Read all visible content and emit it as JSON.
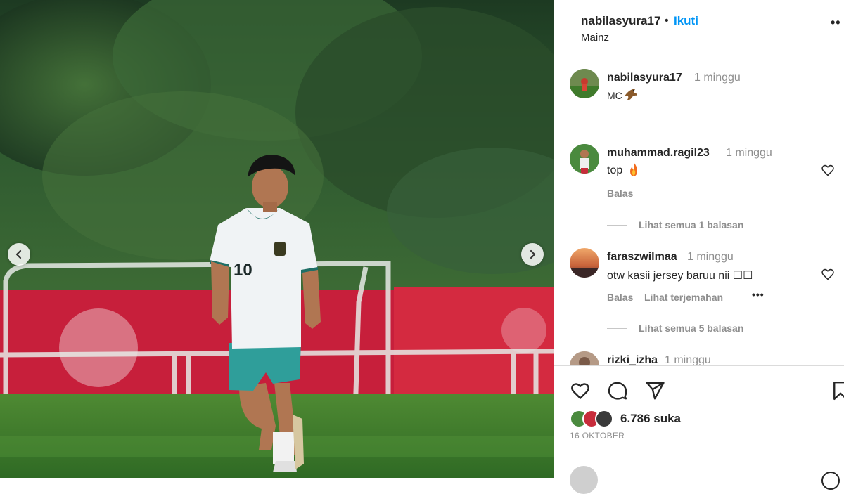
{
  "post": {
    "username": "nabilasyura17",
    "follow_label": "Ikuti",
    "location": "Mainz",
    "more_label": "••"
  },
  "photo": {
    "jersey_number": "10",
    "nav_prev_icon": "chevron-left-icon",
    "nav_next_icon": "chevron-right-icon"
  },
  "caption": {
    "username": "nabilasyura17",
    "time": "1 minggu",
    "text": "MC"
  },
  "comments": [
    {
      "username": "muhammad.ragil23",
      "time": "1 minggu",
      "text": "top",
      "reply_label": "Balas",
      "view_replies": "Lihat semua 1 balasan"
    },
    {
      "username": "faraszwilmaa",
      "time": "1 minggu",
      "text": "otw kasii jersey baruu nii ☐☐",
      "reply_label": "Balas",
      "translate_label": "Lihat terjemahan",
      "more_label": "•••",
      "view_replies": "Lihat semua 5 balasan"
    },
    {
      "username": "rizki_izha",
      "time": "1 minggu"
    }
  ],
  "actions": {
    "like_icon": "heart-icon",
    "comment_icon": "comment-icon",
    "share_icon": "share-icon",
    "save_icon": "bookmark-icon",
    "likes_label": "6.786 suka",
    "date": "16 OKTOBER"
  },
  "colors": {
    "link_blue": "#0095f6",
    "pitch_green": "#3f7a2b",
    "banner_red": "#d7263d"
  }
}
